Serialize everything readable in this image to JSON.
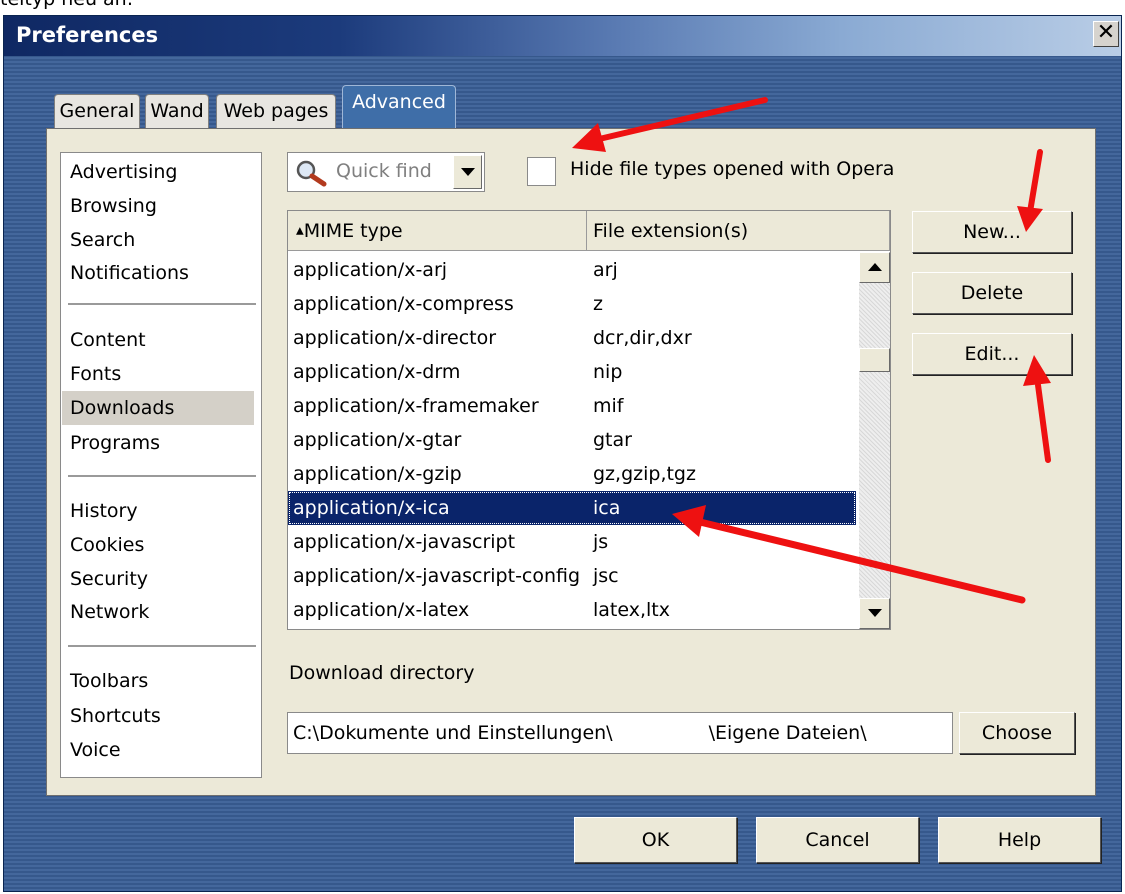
{
  "caption": "teityp neu an:",
  "window": {
    "title": "Preferences",
    "close_glyph": "✕"
  },
  "tabs": [
    {
      "label": "General",
      "active": false
    },
    {
      "label": "Wand",
      "active": false
    },
    {
      "label": "Web pages",
      "active": false
    },
    {
      "label": "Advanced",
      "active": true
    }
  ],
  "sidebar": {
    "groups": [
      [
        "Advertising",
        "Browsing",
        "Search",
        "Notifications"
      ],
      [
        "Content",
        "Fonts",
        "Downloads",
        "Programs"
      ],
      [
        "History",
        "Cookies",
        "Security",
        "Network"
      ],
      [
        "Toolbars",
        "Shortcuts",
        "Voice"
      ]
    ],
    "selected": "Downloads"
  },
  "quick_find": {
    "placeholder": "Quick find",
    "icon": "magnifier-icon"
  },
  "hide_option": {
    "label": "Hide file types opened with Opera",
    "checked": false
  },
  "file_types": {
    "columns": [
      "MIME type",
      "File extension(s)"
    ],
    "sort_indicator": "▲",
    "rows": [
      {
        "mime": "application/x-arj",
        "ext": "arj"
      },
      {
        "mime": "application/x-compress",
        "ext": "z"
      },
      {
        "mime": "application/x-director",
        "ext": "dcr,dir,dxr"
      },
      {
        "mime": "application/x-drm",
        "ext": "nip"
      },
      {
        "mime": "application/x-framemaker",
        "ext": "mif"
      },
      {
        "mime": "application/x-gtar",
        "ext": "gtar"
      },
      {
        "mime": "application/x-gzip",
        "ext": "gz,gzip,tgz"
      },
      {
        "mime": "application/x-ica",
        "ext": "ica"
      },
      {
        "mime": "application/x-javascript",
        "ext": "js"
      },
      {
        "mime": "application/x-javascript-config",
        "ext": "jsc"
      },
      {
        "mime": "application/x-latex",
        "ext": "latex,ltx"
      }
    ],
    "selected_row": 7
  },
  "actions": {
    "new": "New...",
    "delete": "Delete",
    "edit": "Edit..."
  },
  "download": {
    "label": "Download directory",
    "path_prefix": "C:\\Dokumente und Einstellungen\\",
    "path_suffix": "\\Eigene Dateien\\",
    "choose": "Choose"
  },
  "footer": {
    "ok": "OK",
    "cancel": "Cancel",
    "help": "Help"
  },
  "colors": {
    "titlebar_start": "#0f2863",
    "active_tab": "#3f6ea8",
    "selection": "#0a246a",
    "annotation_arrow": "#ee1111"
  }
}
